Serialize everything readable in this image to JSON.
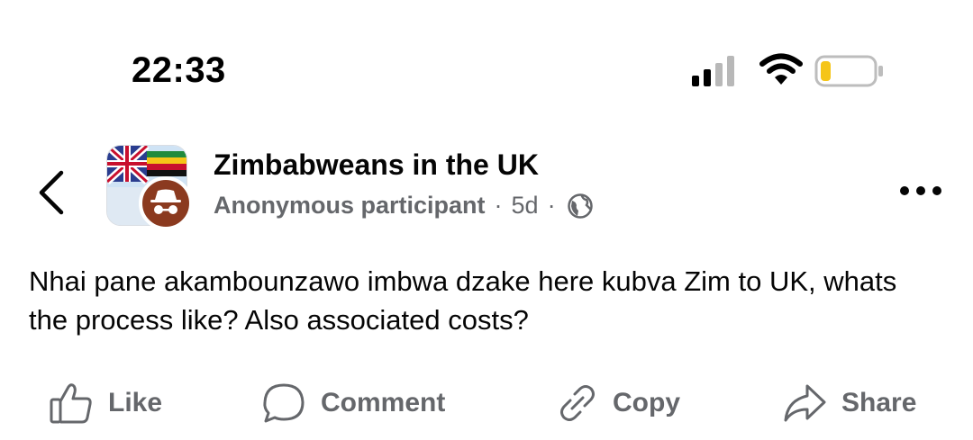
{
  "status_bar": {
    "time": "22:33"
  },
  "post": {
    "group_name": "Zimbabweans in the UK",
    "author": "Anonymous participant",
    "separator": "·",
    "age": "5d",
    "visibility_icon": "globe-icon",
    "text": "Nhai pane akambounzawo imbwa dzake here kubva Zim to UK, whats the process like? Also associated costs?"
  },
  "actions": {
    "like": "Like",
    "comment": "Comment",
    "copy": "Copy",
    "share": "Share"
  },
  "colors": {
    "primary_text": "#050505",
    "secondary_text": "#65676b",
    "battery_level": "#f5c518",
    "anon_badge": "#8b3a1f"
  },
  "battery_level": 0.2
}
